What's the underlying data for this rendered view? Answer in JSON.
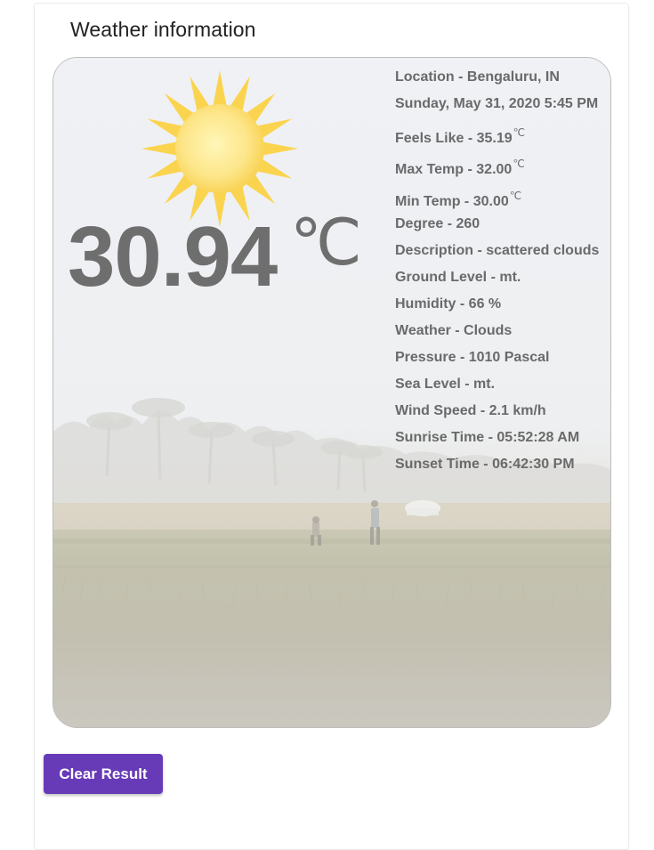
{
  "header": {
    "title": "Weather information"
  },
  "current": {
    "temperature": "30.94",
    "unit_symbol": "℃",
    "icon": "sun-icon"
  },
  "details": {
    "location": "Location - Bengaluru, IN",
    "datetime": "Sunday, May 31, 2020 5:45 PM",
    "feels_like": "Feels Like - 35.19",
    "max_temp": "Max Temp - 32.00",
    "min_temp": "Min Temp - 30.00",
    "degree": "Degree - 260",
    "description": "Description - scattered clouds",
    "ground_level": "Ground Level - mt.",
    "humidity": "Humidity - 66 %",
    "weather": "Weather - Clouds",
    "pressure": "Pressure - 1010 Pascal",
    "sea_level": "Sea Level - mt.",
    "wind_speed": "Wind Speed - 2.1 km/h",
    "sunrise": "Sunrise Time - 05:52:28 AM",
    "sunset": "Sunset Time - 06:42:30 PM"
  },
  "actions": {
    "clear_label": "Clear Result"
  },
  "colors": {
    "button_bg": "#673ab7",
    "button_text": "#ffffff",
    "temperature_text": "#6e6e6e",
    "detail_text": "#6a6a6a"
  }
}
